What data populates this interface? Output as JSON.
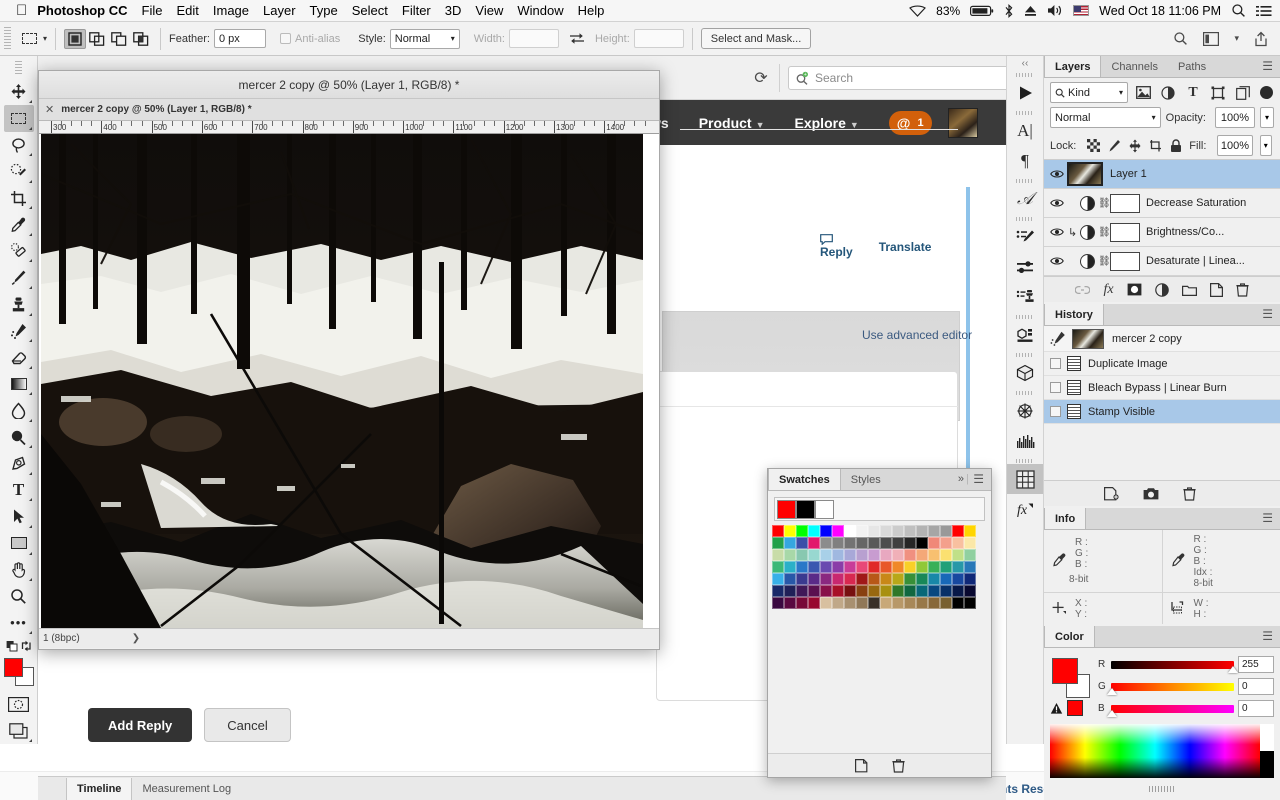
{
  "menubar": {
    "apple_icon": "apple-icon",
    "app_name": "Photoshop CC",
    "items": [
      "File",
      "Edit",
      "Image",
      "Layer",
      "Type",
      "Select",
      "Filter",
      "3D",
      "View",
      "Window",
      "Help"
    ],
    "status": {
      "wifi_icon": "wifi-icon",
      "battery_percent": "83%",
      "battery_icon": "battery-icon",
      "bluetooth_icon": "bluetooth-icon",
      "eject_icon": "eject-icon",
      "volume_icon": "volume-icon",
      "flag_icon": "us-flag-icon",
      "datetime": "Wed Oct 18  11:06 PM",
      "spotlight_icon": "search-icon",
      "notifications_icon": "notification-center-icon"
    }
  },
  "options_bar": {
    "tool_preset": "marquee-tool",
    "modes": [
      "new-selection",
      "add-to-selection",
      "subtract-from-selection",
      "intersect-selection"
    ],
    "feather_label": "Feather:",
    "feather_value": "0 px",
    "antialias_label": "Anti-alias",
    "style_label": "Style:",
    "style_value": "Normal",
    "width_label": "Width:",
    "width_value": "",
    "swap_icon": "swap-icon",
    "height_label": "Height:",
    "height_value": "",
    "select_and_mask": "Select and Mask...",
    "right_icons": [
      "search-icon",
      "workspace-icon",
      "chevron-down-icon",
      "share-icon"
    ]
  },
  "browser": {
    "reload_icon": "reload-icon",
    "search_placeholder": "Search",
    "search_icon": "search-plus-icon",
    "nav": [
      {
        "label": "ws",
        "caret": false
      },
      {
        "label": "Product",
        "caret": true
      },
      {
        "label": "Explore",
        "caret": true
      }
    ],
    "mention_badge": {
      "icon": "@",
      "count": "1"
    },
    "avatar": "user-avatar",
    "post_actions": [
      "Reply",
      "Translate"
    ],
    "advanced_editor": "Use advanced editor",
    "buttons": {
      "primary": "Add Reply",
      "secondary": "Cancel"
    },
    "footer_text": "nts Rese"
  },
  "toolbar": {
    "tools": [
      {
        "name": "move-tool",
        "glyph": "✥",
        "selected": false
      },
      {
        "name": "rectangular-marquee-tool",
        "glyph": "▭",
        "selected": true
      },
      {
        "name": "lasso-tool",
        "glyph": "◯",
        "selected": false
      },
      {
        "name": "quick-selection-tool",
        "glyph": "✎",
        "selected": false
      },
      {
        "name": "crop-tool",
        "glyph": "⌗",
        "selected": false
      },
      {
        "name": "eyedropper-tool",
        "glyph": "⌇",
        "selected": false
      },
      {
        "name": "spot-healing-brush-tool",
        "glyph": "◊",
        "selected": false
      },
      {
        "name": "brush-tool",
        "glyph": "✏",
        "selected": false
      },
      {
        "name": "clone-stamp-tool",
        "glyph": "⌶",
        "selected": false
      },
      {
        "name": "history-brush-tool",
        "glyph": "≯",
        "selected": false
      },
      {
        "name": "eraser-tool",
        "glyph": "◣",
        "selected": false
      },
      {
        "name": "gradient-tool",
        "glyph": "▤",
        "selected": false
      },
      {
        "name": "blur-tool",
        "glyph": "◌",
        "selected": false
      },
      {
        "name": "dodge-tool",
        "glyph": "●",
        "selected": false
      },
      {
        "name": "pen-tool",
        "glyph": "✒",
        "selected": false
      },
      {
        "name": "type-tool",
        "glyph": "T",
        "selected": false
      },
      {
        "name": "path-selection-tool",
        "glyph": "➤",
        "selected": false
      },
      {
        "name": "rectangle-tool",
        "glyph": "▭",
        "selected": false
      },
      {
        "name": "hand-tool",
        "glyph": "✋",
        "selected": false
      },
      {
        "name": "zoom-tool",
        "glyph": "⌕",
        "selected": false
      },
      {
        "name": "more-tools",
        "glyph": "•••",
        "selected": false
      }
    ],
    "quickmask_icon": "quick-mask-icon",
    "screenmode_icon": "screen-mode-icon",
    "foreground_color": "#ff0000",
    "background_color": "#ffffff"
  },
  "document": {
    "title": "mercer 2 copy @ 50% (Layer 1, RGB/8) *",
    "tab_title": "mercer 2 copy @ 50% (Layer 1, RGB/8) *",
    "close_icon": "close-icon",
    "ruler_units": [
      "300",
      "400",
      "500",
      "600",
      "700",
      "800",
      "900",
      "1000",
      "1100",
      "1200",
      "1300",
      "1400"
    ],
    "status": "1 (8bpc)",
    "status_arrow": "chevron-right-icon"
  },
  "dock_strip": {
    "collapse_icon": "collapse-panels-icon",
    "icons": [
      {
        "name": "timeline-play-icon",
        "glyph": "▶"
      },
      {
        "name": "character-panel-icon",
        "glyph": "A"
      },
      {
        "name": "paragraph-panel-icon",
        "glyph": "¶"
      },
      {
        "name": "glyphs-panel-icon",
        "glyph": "𝒜"
      },
      {
        "name": "brush-settings-icon",
        "glyph": "✎"
      },
      {
        "name": "adjustments-icon",
        "glyph": "⇌"
      },
      {
        "name": "clone-source-icon",
        "glyph": "⌶"
      },
      {
        "name": "properties-icon",
        "glyph": "▣"
      },
      {
        "name": "3d-panel-icon",
        "glyph": "⬡"
      },
      {
        "name": "navigator-icon",
        "glyph": "✳"
      },
      {
        "name": "histogram-icon",
        "glyph": "▁▅▇"
      },
      {
        "name": "swatches-panel-icon",
        "glyph": "▦",
        "selected": true
      },
      {
        "name": "styles-panel-icon",
        "glyph": "fx"
      }
    ]
  },
  "layers_panel": {
    "tabs": [
      {
        "label": "Layers",
        "active": true
      },
      {
        "label": "Channels",
        "active": false
      },
      {
        "label": "Paths",
        "active": false
      }
    ],
    "menu_icon": "panel-menu-icon",
    "filter": {
      "search_icon": "search-icon",
      "kind_label": "Kind",
      "chevron": "chevron-down-icon",
      "type_icons": [
        "pixel-filter-icon",
        "adjustment-filter-icon",
        "type-filter-icon",
        "shape-filter-icon",
        "smartobject-filter-icon"
      ],
      "toggle": "filter-toggle-icon"
    },
    "blend_mode": "Normal",
    "opacity_label": "Opacity:",
    "opacity_value": "100%",
    "lock_label": "Lock:",
    "lock_icons": [
      "lock-transparency-icon",
      "lock-image-icon",
      "lock-position-icon",
      "lock-artboard-icon",
      "lock-all-icon"
    ],
    "fill_label": "Fill:",
    "fill_value": "100%",
    "layers": [
      {
        "name": "Layer 1",
        "type": "pixel",
        "visible": true,
        "selected": true
      },
      {
        "name": "Decrease Saturation",
        "type": "adjustment",
        "visible": true,
        "selected": false,
        "clipped": false
      },
      {
        "name": "Brightness/Co...",
        "type": "adjustment",
        "visible": true,
        "selected": false,
        "clipped": true
      },
      {
        "name": "Desaturate | Linea...",
        "type": "adjustment",
        "visible": true,
        "selected": false,
        "clipped": false
      }
    ],
    "footer_icons": [
      "link-layers-icon",
      "layer-fx-icon",
      "add-mask-icon",
      "adjustment-layer-icon",
      "new-group-icon",
      "new-layer-icon",
      "delete-layer-icon"
    ]
  },
  "history_panel": {
    "tab": "History",
    "menu_icon": "panel-menu-icon",
    "snapshot": {
      "icon": "history-brush-icon",
      "name": "mercer 2 copy"
    },
    "states": [
      {
        "label": "Duplicate Image",
        "selected": false
      },
      {
        "label": "Bleach Bypass | Linear Burn",
        "selected": false
      },
      {
        "label": "Stamp Visible",
        "selected": true
      }
    ],
    "footer_icons": [
      "new-document-from-state-icon",
      "new-snapshot-icon",
      "delete-state-icon"
    ]
  },
  "info_panel": {
    "tab": "Info",
    "menu_icon": "panel-menu-icon",
    "left_readout": {
      "icon": "eyedropper-icon",
      "labels": [
        "R :",
        "G :",
        "B :"
      ],
      "depth": "8-bit"
    },
    "right_readout": {
      "icon": "eyedropper-icon",
      "labels": [
        "R :",
        "G :",
        "B :",
        "Idx :"
      ],
      "depth": "8-bit"
    },
    "position": {
      "icon": "crosshair-icon",
      "labels": [
        "X :",
        "Y :"
      ]
    },
    "dimensions": {
      "icon": "selection-size-icon",
      "labels": [
        "W :",
        "H :"
      ]
    }
  },
  "color_panel": {
    "tab": "Color",
    "menu_icon": "panel-menu-icon",
    "foreground": "#ff0000",
    "background": "#ffffff",
    "warning_icon": "out-of-gamut-icon",
    "warning_swatch": "#ff0000",
    "channels": [
      {
        "label": "R",
        "value": "255"
      },
      {
        "label": "G",
        "value": "0"
      },
      {
        "label": "B",
        "value": "0"
      }
    ],
    "spectrum": "color-spectrum-ramp"
  },
  "swatches_panel": {
    "tabs": [
      {
        "label": "Swatches",
        "active": true
      },
      {
        "label": "Styles",
        "active": false
      }
    ],
    "expand_icon": "expand-icon",
    "menu_icon": "panel-menu-icon",
    "recent": [
      "#ff0000",
      "#000000",
      "#ffffff"
    ],
    "colors": [
      "#ff0000",
      "#ffff00",
      "#00ff00",
      "#00ffff",
      "#0000ff",
      "#ff00ff",
      "#ffffff",
      "#f2f2f2",
      "#e6e6e6",
      "#d9d9d9",
      "#cccccc",
      "#bfbfbf",
      "#b3b3b3",
      "#a6a6a6",
      "#999999",
      "#ff0000",
      "#ffd500",
      "#22a04a",
      "#35a7e0",
      "#3b4ea8",
      "#e2176c",
      "#8c8c8c",
      "#808080",
      "#737373",
      "#666666",
      "#595959",
      "#4d4d4d",
      "#404040",
      "#262626",
      "#000000",
      "#f08878",
      "#f4a08c",
      "#f8c0a0",
      "#fbe8a8",
      "#c8dca8",
      "#a8d8a8",
      "#88c8b0",
      "#98d8d0",
      "#a8d0e8",
      "#a0b8e0",
      "#a8a8d8",
      "#b8a0d0",
      "#c89cd0",
      "#e8a8c0",
      "#f0b0b8",
      "#f09080",
      "#f4a878",
      "#f8c070",
      "#fbe070",
      "#c0e088",
      "#90d0a0",
      "#3cb878",
      "#2ab0c8",
      "#2a78c8",
      "#3a58b0",
      "#6a4ab0",
      "#8a3ca8",
      "#c83c98",
      "#e84878",
      "#e02828",
      "#e85828",
      "#f08828",
      "#f8d028",
      "#90c838",
      "#38b058",
      "#20a078",
      "#2898a8",
      "#2878b8",
      "#38b0e8",
      "#2858a8",
      "#3a3a90",
      "#5a2a88",
      "#8a2880",
      "#c82870",
      "#d82850",
      "#a01818",
      "#b85818",
      "#c88818",
      "#b8a818",
      "#389038",
      "#188858",
      "#1888a8",
      "#1868b8",
      "#1848a0",
      "#102878",
      "#182868",
      "#202058",
      "#401858",
      "#5a1050",
      "#88104a",
      "#a81028",
      "#781010",
      "#884010",
      "#986810",
      "#a89010",
      "#307828",
      "#106840",
      "#086878",
      "#084880",
      "#083068",
      "#081848",
      "#080830",
      "#3a0840",
      "#5a0840",
      "#780838",
      "#980830",
      "#d8c0a0",
      "#c0a888",
      "#a89070",
      "#907858",
      "#383028",
      "#c8a878",
      "#b89868",
      "#a88858",
      "#987848",
      "#886838",
      "#786030",
      "#000000",
      "#000000"
    ],
    "footer_icons": [
      "new-swatch-icon",
      "delete-swatch-icon"
    ]
  },
  "timeline_bar": {
    "tabs": [
      {
        "label": "Timeline",
        "active": true
      },
      {
        "label": "Measurement Log",
        "active": false
      }
    ]
  }
}
